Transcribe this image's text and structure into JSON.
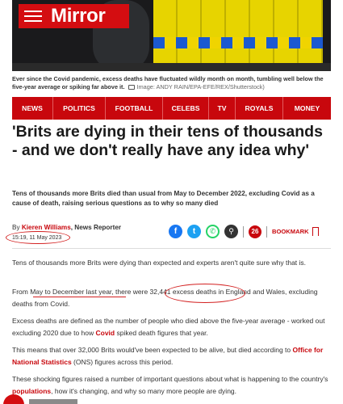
{
  "brand": {
    "logo": "Mirror",
    "accent": "#c8070d"
  },
  "hero": {
    "caption_bold": "Ever since the Covid pandemic, excess deaths have fluctuated wildly month on month, tumbling well below the five-year average or spiking far above it.",
    "credit": "Image: ANDY RAIN/EPA-EFE/REX/Shutterstock)"
  },
  "nav": [
    "NEWS",
    "POLITICS",
    "FOOTBALL",
    "CELEBS",
    "TV",
    "ROYALS",
    "MONEY"
  ],
  "article": {
    "headline": "'Brits are dying in their tens of thousands - and we don't really have any idea why'",
    "standfirst": "Tens of thousands more Brits died than usual from May to December 2022, excluding Covid as a cause of death, raising serious questions as to why so many died",
    "byline_prefix": "By",
    "author": "Kieren Williams",
    "publication": ", News Reporter",
    "date": "15:19, 11 May 2023",
    "comments": "26",
    "bookmark": "BOOKMARK",
    "paragraphs": {
      "p1": "Tens of thousands more Brits were dying than expected and experts aren't quite sure why that is.",
      "p2": "From May to December last year, there were 32,441 excess deaths in England and Wales, excluding deaths from Covid.",
      "p3_a": "Excess deaths are defined as the number of people who died above the five-year average - worked out excluding 2020 due to how ",
      "p3_link": "Covid",
      "p3_b": " spiked death figures that year.",
      "p4_a": "This means that over 32,000 Brits would've been expected to be alive, but died according to ",
      "p4_link": "Office for National Statistics",
      "p4_b": " (ONS) figures across this period.",
      "p5_a": "These shocking figures raised a number of important questions about what is happening to the country's ",
      "p5_link": "populations",
      "p5_b": ", how it's changing, and why so many more people are dying."
    }
  },
  "icons": [
    "facebook-icon",
    "twitter-icon",
    "whatsapp-icon",
    "link-icon",
    "comments-icon",
    "bookmark-icon",
    "camera-icon",
    "hamburger-icon"
  ]
}
